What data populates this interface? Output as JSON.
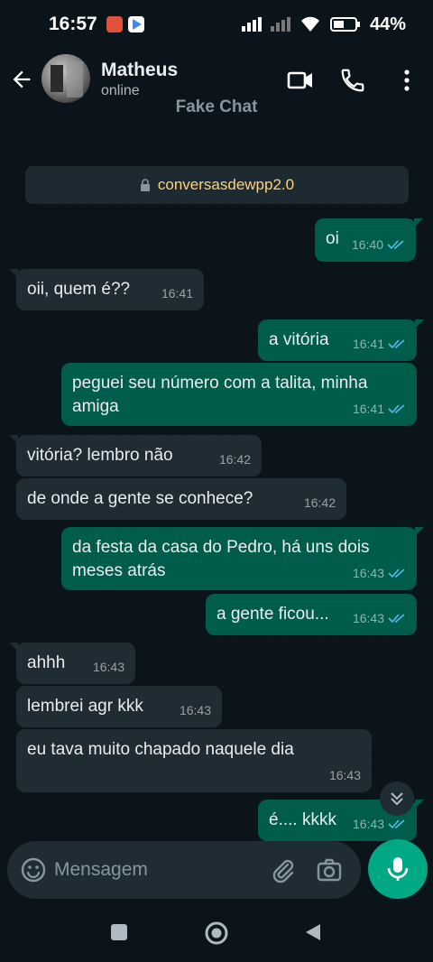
{
  "status_bar": {
    "time": "16:57",
    "battery": "44%"
  },
  "header": {
    "contact_name": "Matheus",
    "contact_status": "online",
    "watermark": "Fake Chat"
  },
  "encryption_notice": "conversasdewpp2.0",
  "messages": [
    {
      "dir": "out",
      "text": "oi",
      "time": "16:40"
    },
    {
      "dir": "in",
      "text": "oii, quem é??",
      "time": "16:41"
    },
    {
      "dir": "out",
      "text": "a vitória",
      "time": "16:41"
    },
    {
      "dir": "out",
      "text": "peguei seu número com a talita, minha amiga",
      "time": "16:41"
    },
    {
      "dir": "in",
      "text": "vitória? lembro não",
      "time": "16:42"
    },
    {
      "dir": "in",
      "text": "de onde a gente se conhece?",
      "time": "16:42"
    },
    {
      "dir": "out",
      "text": "da festa da casa do Pedro, há uns dois meses atrás",
      "time": "16:43"
    },
    {
      "dir": "out",
      "text": "a gente ficou...",
      "time": "16:43"
    },
    {
      "dir": "in",
      "text": "ahhh",
      "time": "16:43"
    },
    {
      "dir": "in",
      "text": "lembrei agr kkk",
      "time": "16:43"
    },
    {
      "dir": "in",
      "text": "eu tava muito chapado naquele dia",
      "time": "16:43"
    },
    {
      "dir": "out",
      "text": "é.... kkkk",
      "time": "16:43"
    }
  ],
  "input": {
    "placeholder": "Mensagem"
  },
  "colors": {
    "background": "#0b141a",
    "incoming_bubble": "#202c33",
    "outgoing_bubble": "#005c4b",
    "accent": "#00a884",
    "read_tick": "#53bdeb",
    "encryption_text": "#ffd279"
  },
  "icons": [
    "back-arrow-icon",
    "video-call-icon",
    "phone-icon",
    "more-vert-icon",
    "lock-icon",
    "read-ticks-icon",
    "chevron-double-down-icon",
    "emoji-icon",
    "attach-icon",
    "camera-icon",
    "mic-icon"
  ]
}
